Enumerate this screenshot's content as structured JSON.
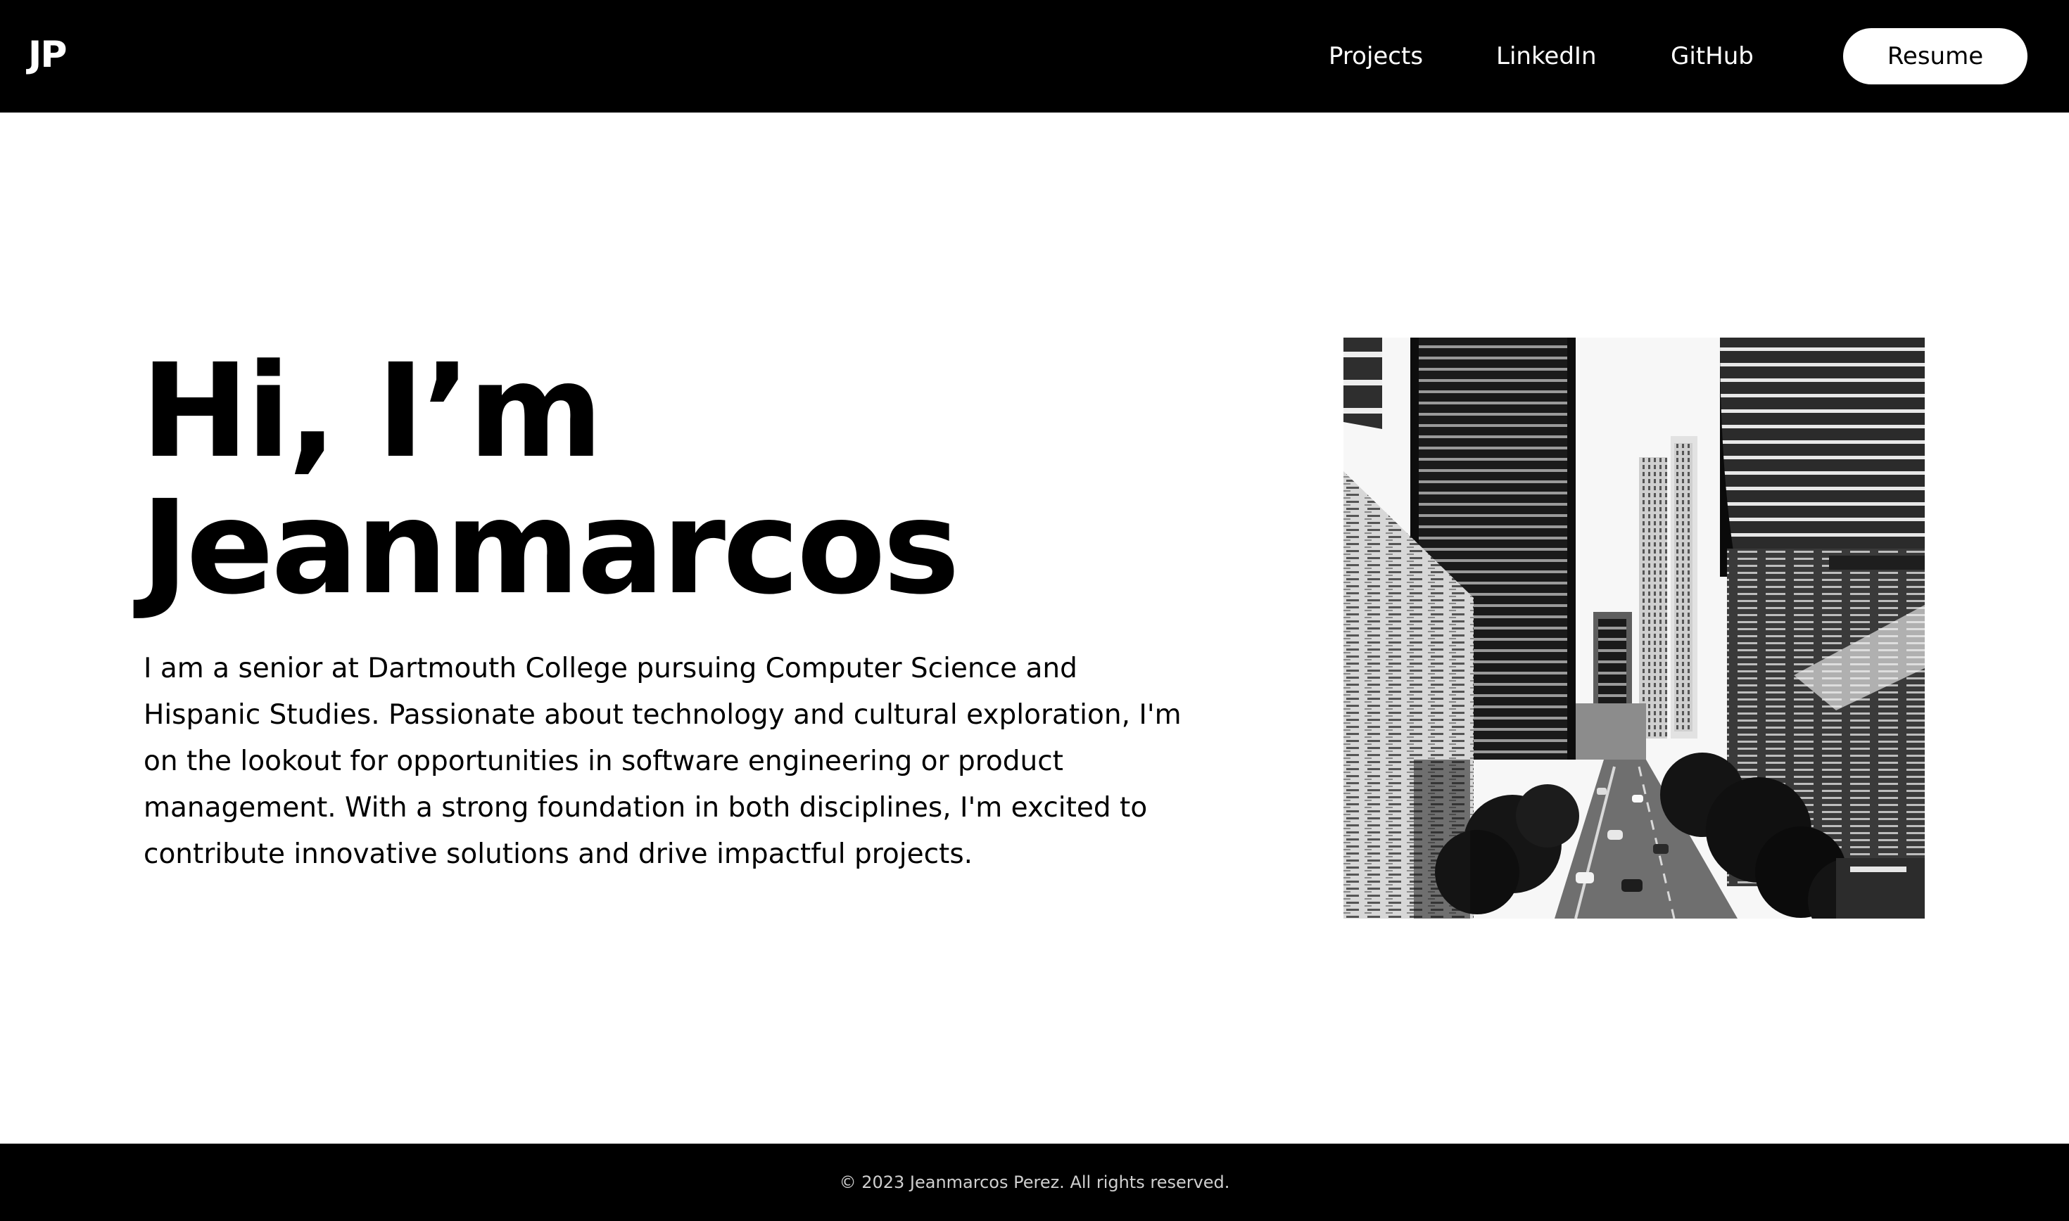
{
  "header": {
    "logo": "JP",
    "nav": {
      "projects": "Projects",
      "linkedin": "LinkedIn",
      "github": "GitHub"
    },
    "resume_label": "Resume"
  },
  "hero": {
    "title_line1": "Hi, I’m",
    "title_line2": "Jeanmarcos",
    "description": "I am a senior at Dartmouth College pursuing Computer Science and Hispanic Studies. Passionate about technology and cultural exploration, I'm on the lookout for opportunities in software engineering or product management. With a strong foundation in both disciplines, I'm excited to contribute innovative solutions and drive impactful projects.",
    "photo_icon": "city-street-photo"
  },
  "footer": {
    "copyright": "© 2023 Jeanmarcos Perez. All rights reserved."
  },
  "colors": {
    "header_bg": "#000000",
    "footer_bg": "#000000",
    "text": "#000000",
    "page_bg": "#ffffff",
    "button_bg": "#ffffff"
  }
}
